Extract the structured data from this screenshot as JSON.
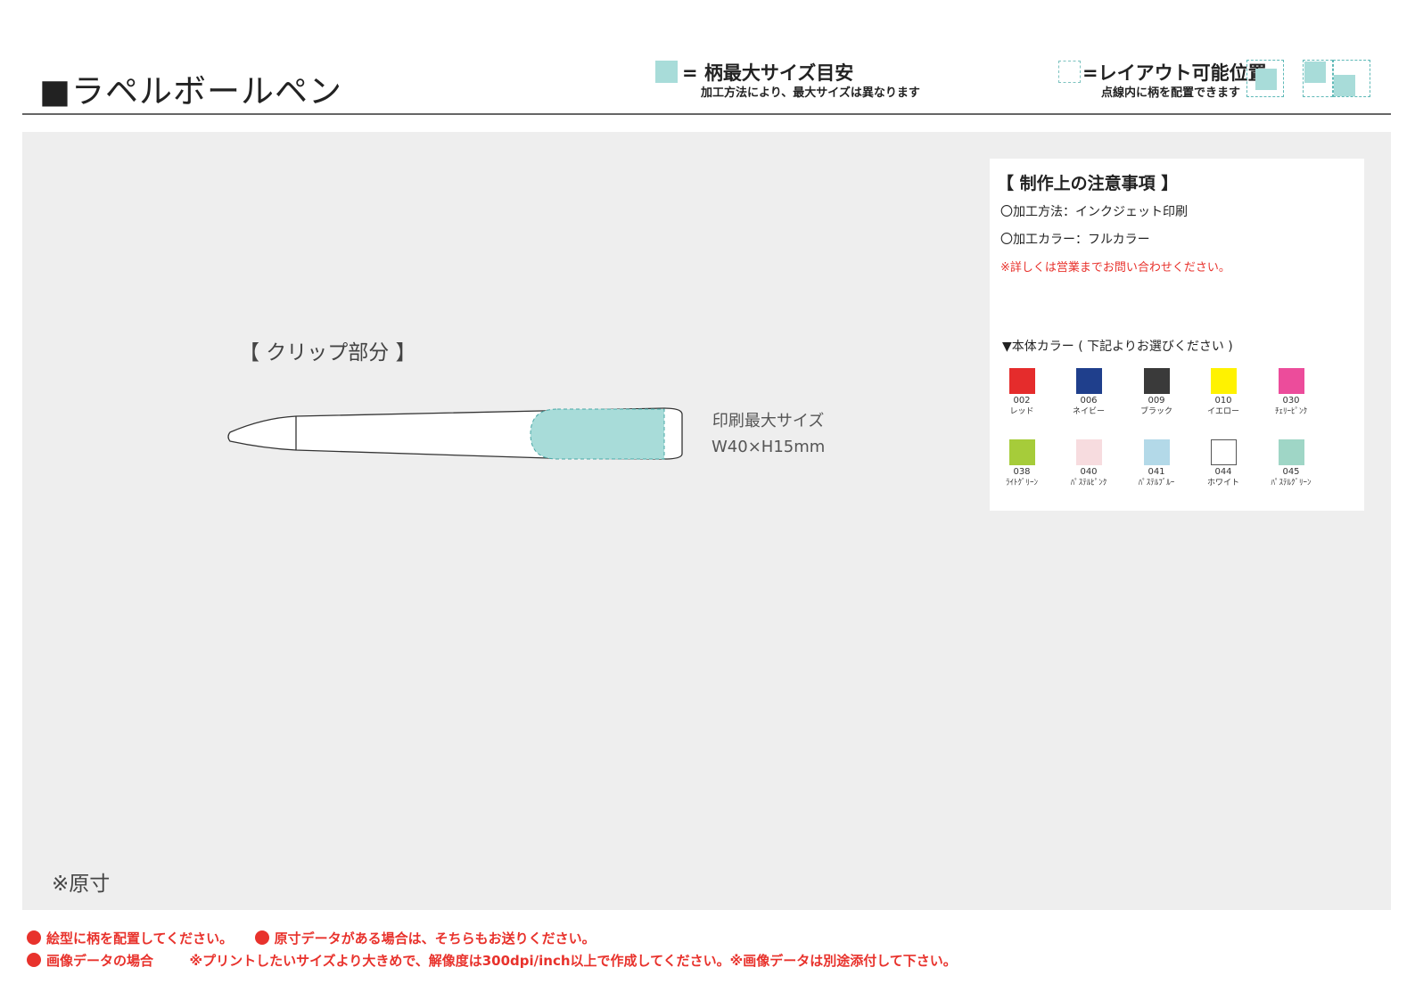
{
  "header": {
    "title": "■ラペルボールペン",
    "legend_max": {
      "main": "= 柄最大サイズ目安",
      "sub": "加工方法により、最大サイズは異なります",
      "color": "#a8dcd9"
    },
    "legend_layout": {
      "main": "=レイアウト可能位置",
      "sub": "点線内に柄を配置できます"
    }
  },
  "drawing": {
    "clip_title": "【 クリップ部分 】",
    "print_size_label": "印刷最大サイズ",
    "print_size_value": "W40×H15mm",
    "original_note": "※原寸"
  },
  "notes": {
    "title": "【 制作上の注意事項 】",
    "method": "〇加工方法：インクジェット印刷",
    "color_mode": "〇加工カラー：フルカラー",
    "warning": "※詳しくは営業までお問い合わせください。",
    "colors_heading": "▼本体カラー ( 下記よりお選びください )",
    "colors": [
      {
        "code": "002",
        "name": "レッド",
        "hex": "#e52c2c"
      },
      {
        "code": "006",
        "name": "ネイビー",
        "hex": "#1f3f8c"
      },
      {
        "code": "009",
        "name": "ブラック",
        "hex": "#3a3a3a"
      },
      {
        "code": "010",
        "name": "イエロー",
        "hex": "#fff200"
      },
      {
        "code": "030",
        "name": "ﾁｪﾘｰﾋﾟﾝｸ",
        "hex": "#ec4c9b"
      },
      {
        "code": "038",
        "name": "ﾗｲﾄｸﾞﾘｰﾝ",
        "hex": "#a6cc3a"
      },
      {
        "code": "040",
        "name": "ﾊﾟｽﾃﾙﾋﾟﾝｸ",
        "hex": "#f7dcdf"
      },
      {
        "code": "041",
        "name": "ﾊﾟｽﾃﾙﾌﾞﾙｰ",
        "hex": "#b3d9e8"
      },
      {
        "code": "044",
        "name": "ホワイト",
        "hex": "#ffffff"
      },
      {
        "code": "045",
        "name": "ﾊﾟｽﾃﾙｸﾞﾘｰﾝ",
        "hex": "#9fd6c6"
      }
    ]
  },
  "footer": {
    "line1_a": "絵型に柄を配置してください。",
    "line1_b": "原寸データがある場合は、そちらもお送りください。",
    "line2_a": "画像データの場合",
    "line2_b": "※プリントしたいサイズより大きめで、解像度は300dpi/inch以上で作成してください。※画像データは別途添付して下さい。",
    "accent": "#e8322c"
  }
}
